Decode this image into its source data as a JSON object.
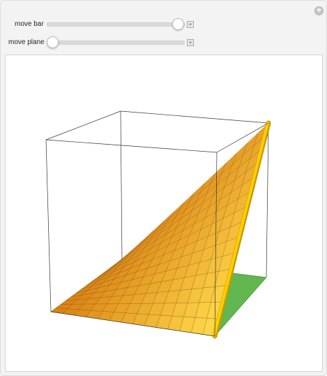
{
  "controls": {
    "move_bar": {
      "label": "move bar",
      "value": 1.0
    },
    "move_plane": {
      "label": "move plane",
      "value": 0.0
    }
  },
  "icons": {
    "corner": "plus-circle-icon",
    "increment": "plus-square-icon"
  },
  "plot": {
    "surface": "z = x*y",
    "colors": {
      "surface_light": "#ffd84a",
      "surface_dark": "#d97f12",
      "plane": "#62b64f",
      "bar": "#ffcf00",
      "box": "#333333"
    }
  }
}
